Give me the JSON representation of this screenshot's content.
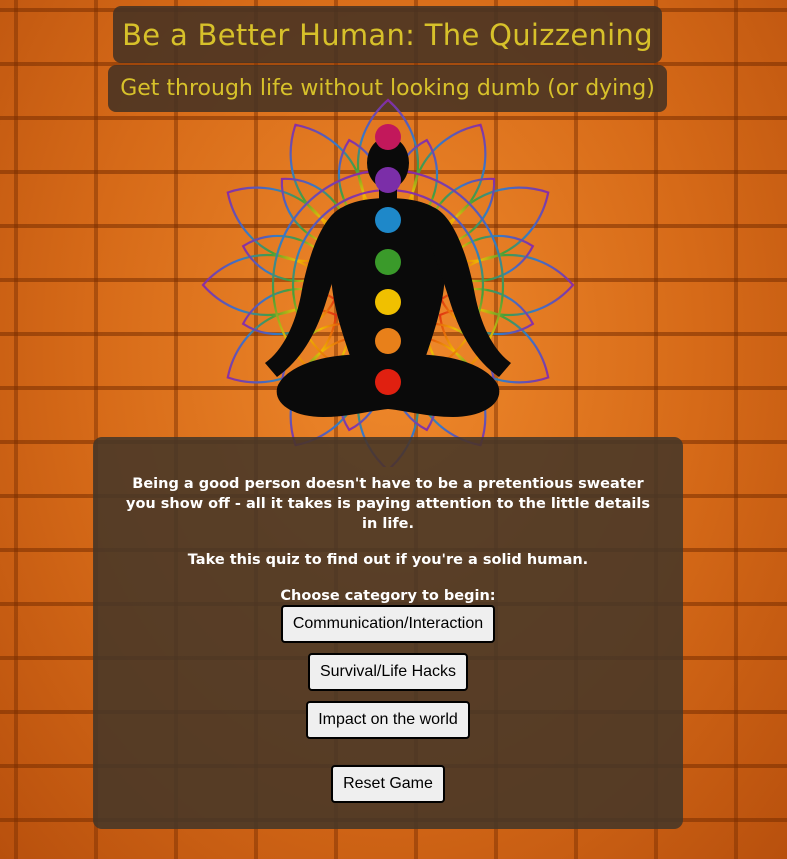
{
  "header": {
    "title": "Be a Better Human: The Quizzening",
    "subtitle": "Get through life without looking dumb (or dying)"
  },
  "hero": {
    "image": "meditation-chakra-mandala-icon",
    "chakra_colors": [
      "#c2185b",
      "#7b2ea8",
      "#1e88c9",
      "#3a9a2a",
      "#f0c000",
      "#e8801a",
      "#e02010"
    ]
  },
  "intro": {
    "paragraph": "Being a good person doesn't have to be a pretentious sweater you show off - all it takes is paying attention to the little details in life.",
    "tagline": "Take this quiz to find out if you're a solid human.",
    "prompt": "Choose category to begin:"
  },
  "categories": [
    {
      "label": "Communication/Interaction"
    },
    {
      "label": "Survival/Life Hacks"
    },
    {
      "label": "Impact on the world"
    }
  ],
  "reset_label": "Reset Game",
  "colors": {
    "title_text": "#d7c12a",
    "panel_bg": "#463728",
    "background": "#d9691a"
  }
}
